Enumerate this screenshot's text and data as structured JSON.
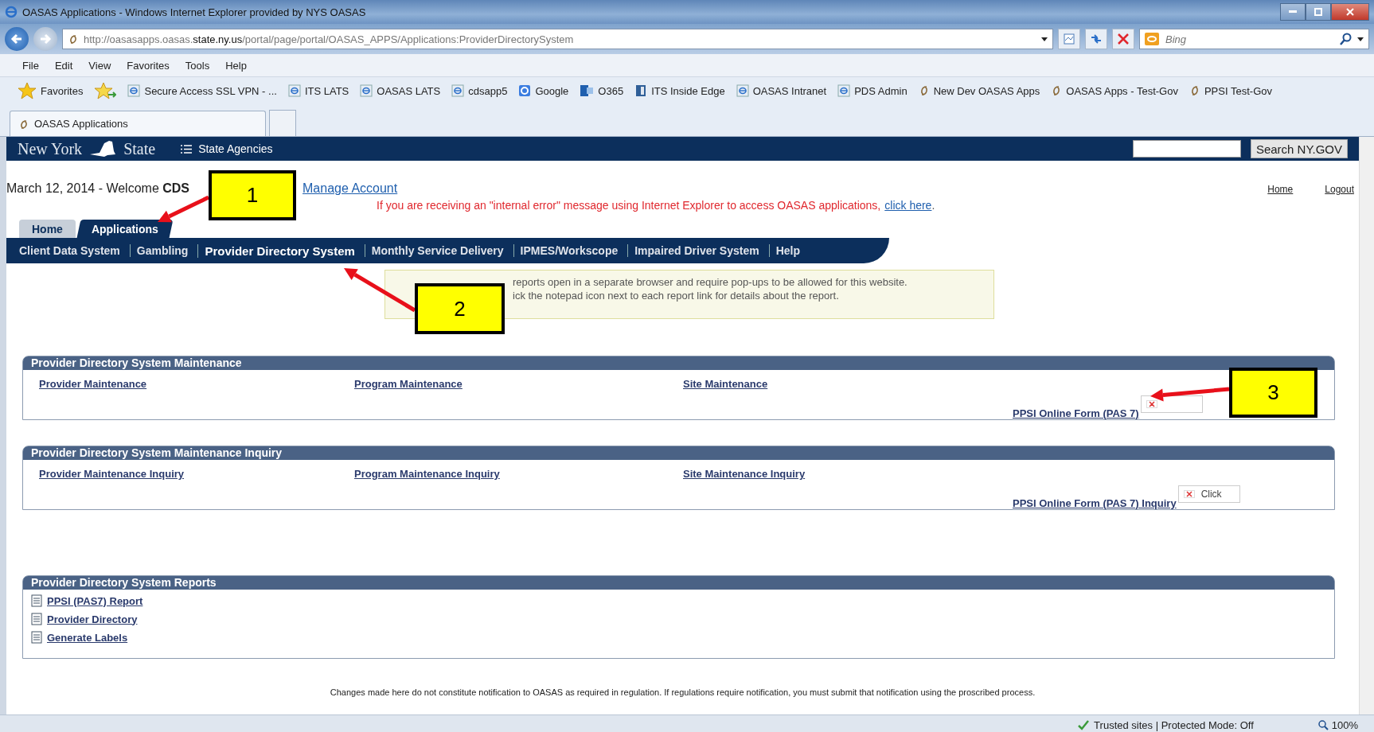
{
  "window": {
    "title": "OASAS Applications - Windows Internet Explorer provided by NYS OASAS"
  },
  "address_bar": {
    "url": "http://oasasapps.oasas.**state.ny.us**/portal/page/portal/OASAS_APPS/Applications:ProviderDirectorySystem"
  },
  "search_box": {
    "placeholder": "Bing"
  },
  "menu": [
    "File",
    "Edit",
    "View",
    "Favorites",
    "Tools",
    "Help"
  ],
  "favorites_bar": {
    "label": "Favorites",
    "links": [
      {
        "text": "Secure Access SSL VPN - ...",
        "kind": "ie"
      },
      {
        "text": "ITS LATS",
        "kind": "ie"
      },
      {
        "text": "OASAS LATS",
        "kind": "ie"
      },
      {
        "text": "cdsapp5",
        "kind": "ie"
      },
      {
        "text": "Google",
        "kind": "google"
      },
      {
        "text": "O365",
        "kind": "outlook"
      },
      {
        "text": "ITS Inside Edge",
        "kind": "book"
      },
      {
        "text": "OASAS Intranet",
        "kind": "ie"
      },
      {
        "text": "PDS Admin",
        "kind": "ie"
      },
      {
        "text": "New Dev OASAS Apps",
        "kind": "swirl"
      },
      {
        "text": "OASAS Apps - Test-Gov",
        "kind": "swirl"
      },
      {
        "text": "PPSI Test-Gov",
        "kind": "swirl"
      }
    ]
  },
  "browser_tabs": [
    {
      "label": "OASAS Applications",
      "selected": true
    }
  ],
  "site_header": {
    "logo_left": "New York",
    "logo_right": "State",
    "agencies": "State Agencies",
    "search_button": "Search NY.GOV"
  },
  "welcome": {
    "text": "March 12, 2014 - Welcome **CDS**",
    "manage_link": "Manage Account",
    "home_link": "Home",
    "logout_link": "Logout"
  },
  "alert": {
    "text": "If you are receiving an \"internal error\" message using Internet Explorer to access OASAS applications,",
    "link": "click here",
    "tail": "."
  },
  "tabs": [
    {
      "label": "Home",
      "selected": false
    },
    {
      "label": "Applications",
      "selected": true
    }
  ],
  "nav": [
    {
      "label": "Client Data System",
      "selected": false
    },
    {
      "label": "Gambling",
      "selected": false
    },
    {
      "label": "Provider Directory System",
      "selected": true
    },
    {
      "label": "Monthly Service Delivery",
      "selected": false
    },
    {
      "label": "IPMES/Workscope",
      "selected": false
    },
    {
      "label": "Impaired Driver System",
      "selected": false
    },
    {
      "label": "Help",
      "selected": false
    }
  ],
  "note": [
    "reports open in a separate browser and require pop-ups to be allowed for this website.",
    "ick the notepad icon next to each report link for details about the report."
  ],
  "sections": [
    {
      "title": "Provider Directory System Maintenance",
      "kind": "grid",
      "links": [
        {
          "text": "Provider Maintenance"
        },
        {
          "text": "Program Maintenance"
        },
        {
          "text": "Site Maintenance"
        },
        {
          "text": "PPSI Online Form (PAS 7)",
          "image_button": true
        }
      ]
    },
    {
      "title": "Provider Directory System Maintenance Inquiry",
      "kind": "grid",
      "links": [
        {
          "text": "Provider Maintenance Inquiry"
        },
        {
          "text": "Program Maintenance Inquiry"
        },
        {
          "text": "Site Maintenance Inquiry"
        },
        {
          "text": "PPSI Online Form (PAS 7) Inquiry",
          "image_button": true,
          "button_text": "Click"
        }
      ]
    },
    {
      "title": "Provider Directory System Reports",
      "kind": "reports",
      "links": [
        {
          "text": "PPSI (PAS7) Report"
        },
        {
          "text": "Provider Directory"
        },
        {
          "text": "Generate Labels"
        }
      ]
    }
  ],
  "footer": "Changes made here do not constitute notification to OASAS as required in regulation. If regulations require notification, you must submit that notification using the proscribed process.",
  "status_bar": {
    "zone": "Trusted sites | Protected Mode: Off",
    "zoom": "100%"
  },
  "callouts": [
    {
      "label": "1"
    },
    {
      "label": "2"
    },
    {
      "label": "3"
    }
  ]
}
